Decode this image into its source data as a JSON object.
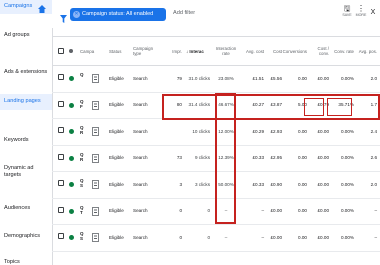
{
  "sidebar": {
    "items": [
      {
        "label": "Campaigns",
        "active": true
      },
      {
        "label": "Ad groups"
      },
      {
        "label": "Ads & extensions"
      },
      {
        "label": "Landing pages",
        "active": true
      },
      {
        "label": "Keywords"
      },
      {
        "label": "Dynamic ad targets"
      },
      {
        "label": "Audiences"
      },
      {
        "label": "Demographics"
      },
      {
        "label": "Topics"
      }
    ]
  },
  "toolbar": {
    "filter_chip": "Campaign status: All enabled",
    "add_filter": "Add filter",
    "save_label": "SAVE",
    "more_label": "MORE",
    "close_label": "X"
  },
  "table": {
    "headers": {
      "campaign": "Campa",
      "status": "Status",
      "campaign_type": "Campaign type",
      "impr": "Impr.",
      "interactions": "Interac",
      "interaction_rate": "Interaction rate",
      "avg_cost": "Avg. cost",
      "cost": "Cost",
      "conversions": "Conversions",
      "cost_conv": "Cost / conv.",
      "conv_rate": "Conv. rate",
      "avg_pos": "Avg. pos."
    },
    "rows": [
      {
        "status": "Eligible",
        "type": "Search",
        "impr": "79",
        "interactions": "31.0 clicks",
        "rate": "23.08%",
        "avg_cost": "£1.51",
        "cost": "£5.56",
        "conversions": "0.00",
        "cost_conv": "£0.00",
        "conv_rate": "0.00%",
        "avg_pos": "2.0",
        "mini": "Q"
      },
      {
        "status": "Eligible",
        "type": "Search",
        "impr": "80",
        "interactions": "31.4 clicks",
        "rate": "46.67%",
        "avg_cost": "£0.27",
        "cost": "£3.87",
        "conversions": "5.00",
        "cost_conv": "£0.79",
        "conv_rate": "35.71%",
        "avg_pos": "1.7",
        "mini": "Q\nF"
      },
      {
        "status": "Eligible",
        "type": "Search",
        "impr": "",
        "interactions": "10 clicks",
        "rate": "12.00%",
        "avg_cost": "£0.29",
        "cost": "£2.93",
        "conversions": "0.00",
        "cost_conv": "£0.00",
        "conv_rate": "0.00%",
        "avg_pos": "2.4",
        "mini": "Q\nR"
      },
      {
        "status": "Eligible",
        "type": "Search",
        "impr": "73",
        "interactions": "9 clicks",
        "rate": "12.39%",
        "avg_cost": "£0.33",
        "cost": "£2.95",
        "conversions": "0.00",
        "cost_conv": "£0.00",
        "conv_rate": "0.00%",
        "avg_pos": "2.6",
        "mini": "Q\nR"
      },
      {
        "status": "Eligible",
        "type": "Search",
        "impr": "3",
        "interactions": "3 clicks",
        "rate": "50.00%",
        "avg_cost": "£0.33",
        "cost": "£0.90",
        "conversions": "0.00",
        "cost_conv": "£0.00",
        "conv_rate": "0.00%",
        "avg_pos": "2.0",
        "mini": "Q\nS"
      },
      {
        "status": "Eligible",
        "type": "Search",
        "impr": "0",
        "interactions": "0",
        "rate": "–",
        "avg_cost": "–",
        "cost": "£0.00",
        "conversions": "0.00",
        "cost_conv": "£0.00",
        "conv_rate": "0.00%",
        "avg_pos": "–",
        "mini": "Q\nT"
      },
      {
        "status": "Eligible",
        "type": "Search",
        "impr": "0",
        "interactions": "0",
        "rate": "–",
        "avg_cost": "–",
        "cost": "£0.00",
        "conversions": "0.00",
        "cost_conv": "£0.00",
        "conv_rate": "0.00%",
        "avg_pos": "–",
        "mini": "Q\nS"
      }
    ]
  },
  "colors": {
    "accent": "#1a73e8",
    "highlight": "#c5221f",
    "status_green": "#0b8043"
  }
}
